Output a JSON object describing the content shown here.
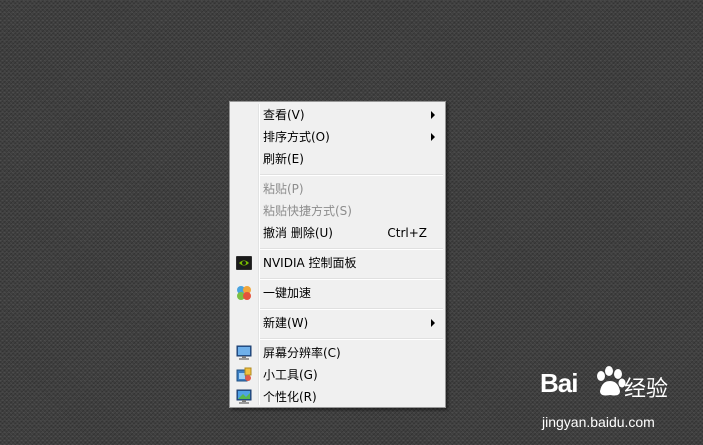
{
  "menu": {
    "items": [
      {
        "label": "查看(V)",
        "submenu": true
      },
      {
        "label": "排序方式(O)",
        "submenu": true
      },
      {
        "label": "刷新(E)"
      },
      {
        "label": "粘贴(P)",
        "disabled": true
      },
      {
        "label": "粘贴快捷方式(S)",
        "disabled": true
      },
      {
        "label": "撤消 删除(U)",
        "shortcut": "Ctrl+Z"
      },
      {
        "label": "NVIDIA 控制面板",
        "icon": "nvidia-icon"
      },
      {
        "label": "一键加速",
        "icon": "speedup-icon"
      },
      {
        "label": "新建(W)",
        "submenu": true
      },
      {
        "label": "屏幕分辨率(C)",
        "icon": "display-icon"
      },
      {
        "label": "小工具(G)",
        "icon": "gadgets-icon"
      },
      {
        "label": "个性化(R)",
        "icon": "personalize-icon"
      }
    ]
  },
  "watermark": {
    "brand_left": "Bai",
    "brand_right": "经验",
    "url": "jingyan.baidu.com"
  },
  "colors": {
    "desktop": "#3e3e3e",
    "menu_bg": "#f0f0f0",
    "menu_border": "#979797",
    "disabled_text": "#8d8d8d"
  }
}
